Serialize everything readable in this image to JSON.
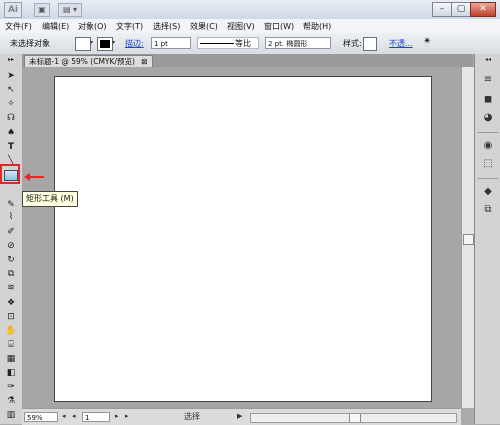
{
  "titlebar": {
    "logo": "Ai",
    "buttons": [
      "▣",
      "▤ ▾"
    ],
    "window_controls": {
      "minimize": "–",
      "restore": "▢",
      "close": "✕"
    }
  },
  "menubar": [
    "文件(F)",
    "编辑(E)",
    "对象(O)",
    "文字(T)",
    "选择(S)",
    "效果(C)",
    "视图(V)",
    "窗口(W)",
    "帮助(H)"
  ],
  "controlbar": {
    "selection_status": "未选择对象",
    "stroke_label": "描边:",
    "stroke_value": "1 pt",
    "profile_label": "等比",
    "brush_value": "2 pt. 椭圆形",
    "style_label": "样式:",
    "opacity_link": "不透..."
  },
  "document": {
    "tab_title": "未标题-1 @ 59% (CMYK/预览)",
    "tab_close": "⊠"
  },
  "tools": {
    "items": [
      "➤",
      "↖",
      "✧",
      "☊",
      "♠",
      "T",
      "╲",
      "▭",
      "✎",
      "⌇",
      "✐",
      "⊘",
      "↻",
      "⧉",
      "≋",
      "❖",
      "⊡",
      "✋",
      "⌸",
      "▦",
      "◧",
      "✑",
      "⚗",
      "⬢",
      "▥",
      "▣"
    ],
    "tooltip": "矩形工具 (M)"
  },
  "statusbar": {
    "zoom": "59%",
    "page": "1",
    "nav_first": "◂",
    "nav_prev": "◂",
    "nav_next": "▸",
    "nav_last": "▸",
    "mode_label": "选择",
    "mode_arrow": "▶"
  },
  "right_panel": [
    "≡",
    "◼",
    "◕",
    "◉",
    "⬚",
    "◆",
    "⧉"
  ],
  "colors": {
    "highlight": "#e0282a",
    "tooltip_bg": "#ffffe1",
    "link": "#1a46c8"
  }
}
